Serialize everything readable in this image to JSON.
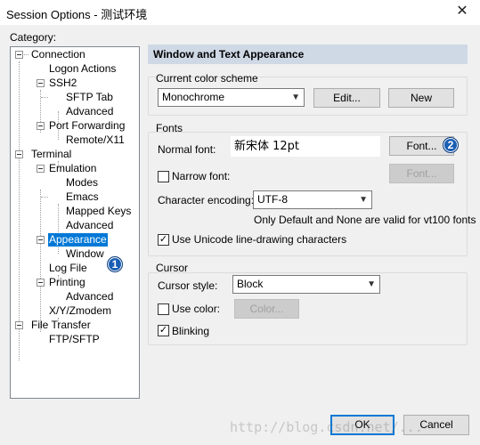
{
  "window": {
    "title": "Session Options - 测试环境",
    "close_glyph": "✕"
  },
  "category": {
    "label": "Category:",
    "tree": [
      {
        "label": "Connection"
      },
      {
        "label": "Logon Actions"
      },
      {
        "label": "SSH2"
      },
      {
        "label": "SFTP Tab"
      },
      {
        "label": "Advanced"
      },
      {
        "label": "Port Forwarding"
      },
      {
        "label": "Remote/X11"
      },
      {
        "label": "Terminal"
      },
      {
        "label": "Emulation"
      },
      {
        "label": "Modes"
      },
      {
        "label": "Emacs"
      },
      {
        "label": "Mapped Keys"
      },
      {
        "label": "Advanced"
      },
      {
        "label": "Appearance"
      },
      {
        "label": "Window"
      },
      {
        "label": "Log File"
      },
      {
        "label": "Printing"
      },
      {
        "label": "Advanced"
      },
      {
        "label": "X/Y/Zmodem"
      },
      {
        "label": "File Transfer"
      },
      {
        "label": "FTP/SFTP"
      }
    ]
  },
  "badges": {
    "one": "1",
    "two": "2"
  },
  "panel": {
    "header": "Window and Text Appearance",
    "color_scheme": {
      "group_label": "Current color scheme",
      "selected": "Monochrome",
      "edit_button": "Edit...",
      "new_button": "New"
    },
    "fonts": {
      "group_label": "Fonts",
      "normal_font_label": "Normal font:",
      "normal_font_value": "新宋体 12pt",
      "font_button": "Font...",
      "narrow_font_label": "Narrow font:",
      "narrow_font_button": "Font...",
      "encoding_label": "Character encoding:",
      "encoding_value": "UTF-8",
      "vt100_note": "Only Default and None are valid for vt100 fonts",
      "unicode_label": "Use Unicode line-drawing characters",
      "narrow_checked": false,
      "unicode_checked": true
    },
    "cursor": {
      "group_label": "Cursor",
      "style_label": "Cursor style:",
      "style_value": "Block",
      "use_color_label": "Use color:",
      "color_button": "Color...",
      "blinking_label": "Blinking",
      "use_color_checked": false,
      "blinking_checked": true
    }
  },
  "footer": {
    "ok_button": "OK",
    "cancel_button": "Cancel",
    "watermark": "http://blog.csdn.net/..."
  },
  "colors": {
    "selection": "#0078d7",
    "badge": "#1a5fb4",
    "header_bar": "#cfd9e6",
    "dialog_bg": "#f0f0f0"
  }
}
